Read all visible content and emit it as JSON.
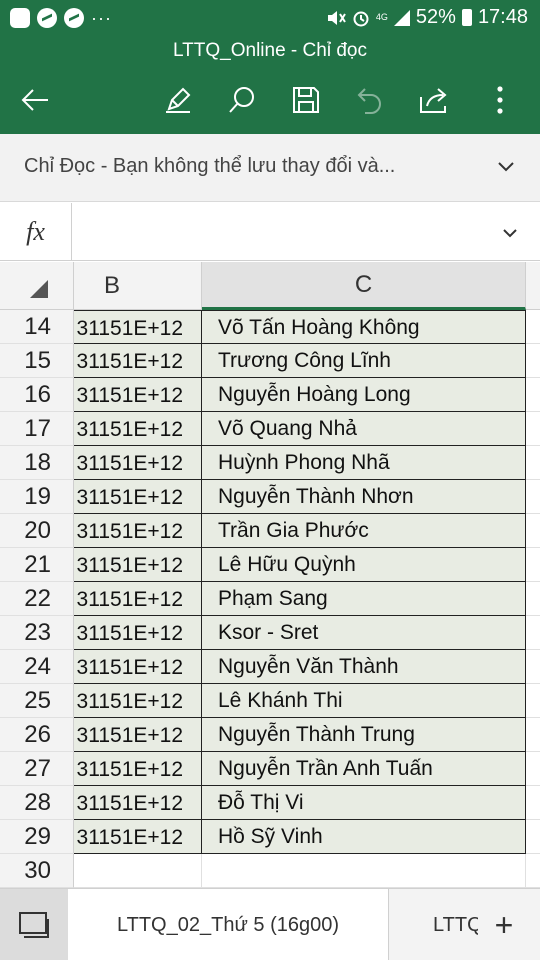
{
  "status_bar": {
    "app_icons": [
      "app-icon",
      "messenger-icon",
      "messenger-icon"
    ],
    "more": "···",
    "network": "4G",
    "battery": "52%",
    "time": "17:48"
  },
  "header": {
    "title": "LTTQ_Online - Chỉ đọc",
    "toolbar": [
      "back-arrow-icon",
      "pen-icon",
      "search-icon",
      "save-icon",
      "undo-icon",
      "share-icon",
      "more-vertical-icon"
    ]
  },
  "infobar": {
    "text": "Chỉ Đọc - Bạn không thể lưu thay đổi và..."
  },
  "formula_bar": {
    "fx_label": "fx",
    "value": ""
  },
  "grid": {
    "columns": [
      "B",
      "C"
    ],
    "rows": [
      {
        "num": "14",
        "b": "31151E+12",
        "c": "Võ Tấn Hoàng Không"
      },
      {
        "num": "15",
        "b": "31151E+12",
        "c": "Trương Công Lĩnh"
      },
      {
        "num": "16",
        "b": "31151E+12",
        "c": "Nguyễn Hoàng Long"
      },
      {
        "num": "17",
        "b": "31151E+12",
        "c": "Võ Quang Nhả"
      },
      {
        "num": "18",
        "b": "31151E+12",
        "c": "Huỳnh Phong Nhã"
      },
      {
        "num": "19",
        "b": "31151E+12",
        "c": "Nguyễn Thành Nhơn"
      },
      {
        "num": "20",
        "b": "31151E+12",
        "c": "Trần Gia Phước"
      },
      {
        "num": "21",
        "b": "31151E+12",
        "c": "Lê Hữu Quỳnh"
      },
      {
        "num": "22",
        "b": "31151E+12",
        "c": "Phạm Sang"
      },
      {
        "num": "23",
        "b": "31151E+12",
        "c": "Ksor - Sret"
      },
      {
        "num": "24",
        "b": "31151E+12",
        "c": "Nguyễn Văn Thành"
      },
      {
        "num": "25",
        "b": "31151E+12",
        "c": "Lê Khánh Thi"
      },
      {
        "num": "26",
        "b": "31151E+12",
        "c": "Nguyễn Thành Trung"
      },
      {
        "num": "27",
        "b": "31151E+12",
        "c": "Nguyễn Trần Anh Tuấn"
      },
      {
        "num": "28",
        "b": "31151E+12",
        "c": "Đỗ Thị Vi"
      },
      {
        "num": "29",
        "b": "31151E+12",
        "c": "Hồ Sỹ Vinh"
      },
      {
        "num": "30",
        "b": "",
        "c": ""
      }
    ]
  },
  "tabs": {
    "active": "LTTQ_02_Thứ 5 (16g00)",
    "next": "LTTQ",
    "add": "+"
  },
  "colors": {
    "header_green": "#217346",
    "cell_fill": "#e8ece3"
  }
}
